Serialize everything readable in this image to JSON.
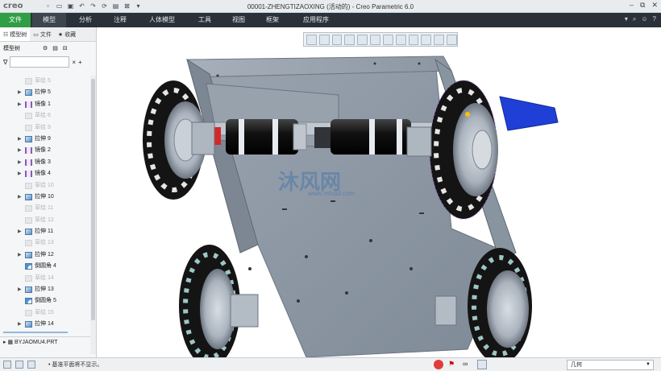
{
  "titlebar": {
    "logo": "creo",
    "title": "00001-ZHENGTIZAOXING (活动的) - Creo Parametric 6.0",
    "window_controls": [
      "–",
      "⧉",
      "✕"
    ]
  },
  "ribbon": {
    "tabs": [
      "文件",
      "模型",
      "分析",
      "注释",
      "人体模型",
      "工具",
      "视图",
      "框架",
      "应用程序"
    ],
    "active_tab": "模型"
  },
  "left_panel": {
    "tabs": [
      "模型树",
      "文件",
      "收藏"
    ],
    "tree_header": "模型树",
    "filter": {
      "value": "",
      "placeholder": ""
    },
    "items": [
      {
        "label": "草绘 5",
        "icon": "sketch-icon",
        "dim": true,
        "expand": false
      },
      {
        "label": "拉伸 5",
        "icon": "extrude-icon",
        "dim": false,
        "expand": true
      },
      {
        "label": "镜像 1",
        "icon": "mirror-icon",
        "dim": false,
        "expand": true
      },
      {
        "label": "草绘 6",
        "icon": "sketch-icon",
        "dim": true,
        "expand": false
      },
      {
        "label": "草绘 9",
        "icon": "sketch-icon",
        "dim": true,
        "expand": false
      },
      {
        "label": "拉伸 9",
        "icon": "extrude-icon",
        "dim": false,
        "expand": true
      },
      {
        "label": "镜像 2",
        "icon": "mirror-icon",
        "dim": false,
        "expand": true
      },
      {
        "label": "镜像 3",
        "icon": "mirror-icon",
        "dim": false,
        "expand": true
      },
      {
        "label": "镜像 4",
        "icon": "mirror-icon",
        "dim": false,
        "expand": true
      },
      {
        "label": "草绘 10",
        "icon": "sketch-icon",
        "dim": true,
        "expand": false
      },
      {
        "label": "拉伸 10",
        "icon": "extrude-icon",
        "dim": false,
        "expand": true
      },
      {
        "label": "草绘 11",
        "icon": "sketch-icon",
        "dim": true,
        "expand": false
      },
      {
        "label": "草绘 12",
        "icon": "sketch-icon",
        "dim": true,
        "expand": false
      },
      {
        "label": "拉伸 11",
        "icon": "extrude-icon",
        "dim": false,
        "expand": true
      },
      {
        "label": "草绘 13",
        "icon": "sketch-icon",
        "dim": true,
        "expand": false
      },
      {
        "label": "拉伸 12",
        "icon": "extrude-icon",
        "dim": false,
        "expand": true
      },
      {
        "label": "倒圆角 4",
        "icon": "round-icon",
        "dim": false,
        "expand": false
      },
      {
        "label": "草绘 14",
        "icon": "sketch-icon",
        "dim": true,
        "expand": false
      },
      {
        "label": "拉伸 13",
        "icon": "extrude-icon",
        "dim": false,
        "expand": true
      },
      {
        "label": "倒圆角 5",
        "icon": "round-icon",
        "dim": false,
        "expand": false
      },
      {
        "label": "草绘 15",
        "icon": "sketch-icon",
        "dim": true,
        "expand": false
      },
      {
        "label": "拉伸 14",
        "icon": "extrude-icon",
        "dim": false,
        "expand": true
      }
    ],
    "part_row": "BYJAOMU4.PRT"
  },
  "statusbar": {
    "message": "• 基准平面将不显示。",
    "selection_filter": "几何"
  },
  "viewport": {
    "watermark": "沐风网",
    "watermark_sub": "www.mfcad.com"
  },
  "colors": {
    "ribbon_bg": "#2b3138",
    "file_tab": "#2f9e44",
    "frame": "#8f99a6",
    "tire": "#1a1a1a",
    "hub": "#a9b2bc",
    "accent_blue": "#1f3fd6"
  }
}
